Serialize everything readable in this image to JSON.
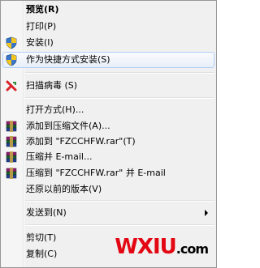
{
  "menu": {
    "preview": "预览(R)",
    "print": "打印(P)",
    "install": "安装(I)",
    "install_as_shortcut": "作为快捷方式安装(S)",
    "scan_virus": "扫描病毒 (S)",
    "open_with": "打开方式(H)...",
    "add_to_archive": "添加到压缩文件(A)...",
    "add_to_named_archive": "添加到 \"FZCCHFW.rar\"(T)",
    "compress_email": "压缩并 E-mail...",
    "compress_to_named_email": "压缩到 \"FZCCHFW.rar\" 并 E-mail",
    "restore_previous": "还原以前的版本(V)",
    "send_to": "发送到(N)",
    "cut": "剪切(T)",
    "copy": "复制(C)"
  },
  "watermark": {
    "main": "WXIU",
    "suffix": ".com"
  },
  "colors": {
    "highlight_border": "#aecff7",
    "menu_background": "#f0f0f0",
    "watermark_red": "#e30613"
  },
  "icons": {
    "install": "uac-shield-icon",
    "install_as_shortcut": "uac-shield-icon",
    "scan_virus": "antivirus-icon",
    "archive": "winrar-books-icon"
  }
}
